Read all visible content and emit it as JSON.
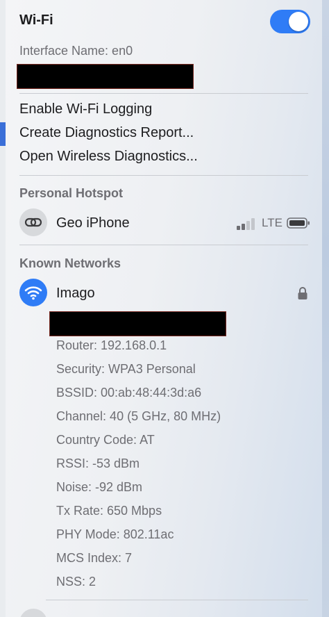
{
  "header": {
    "title": "Wi-Fi",
    "toggle_on": true,
    "toggle_color": "#2f7cf6"
  },
  "interface": {
    "label": "Interface Name: en0"
  },
  "menu": {
    "items": [
      {
        "label": "Enable Wi-Fi Logging"
      },
      {
        "label": "Create Diagnostics Report..."
      },
      {
        "label": "Open Wireless Diagnostics..."
      }
    ]
  },
  "hotspot": {
    "section_title": "Personal Hotspot",
    "device_name": "Geo iPhone",
    "network_type": "LTE",
    "signal_bars": 4,
    "signal_bars_active": 2,
    "icon": "link-icon"
  },
  "known_networks": {
    "section_title": "Known Networks",
    "network": {
      "name": "Imago",
      "icon": "wifi-icon",
      "secured": true,
      "details": [
        "Router: 192.168.0.1",
        "Security: WPA3 Personal",
        "BSSID: 00:ab:48:44:3d:a6",
        "Channel: 40 (5 GHz, 80 MHz)",
        "Country Code: AT",
        "RSSI: -53 dBm",
        "Noise: -92 dBm",
        "Tx Rate: 650 Mbps",
        "PHY Mode: 802.11ac",
        "MCS Index: 7",
        "NSS: 2"
      ]
    }
  },
  "colors": {
    "accent": "#2f7cf6",
    "redaction": "#000000"
  }
}
